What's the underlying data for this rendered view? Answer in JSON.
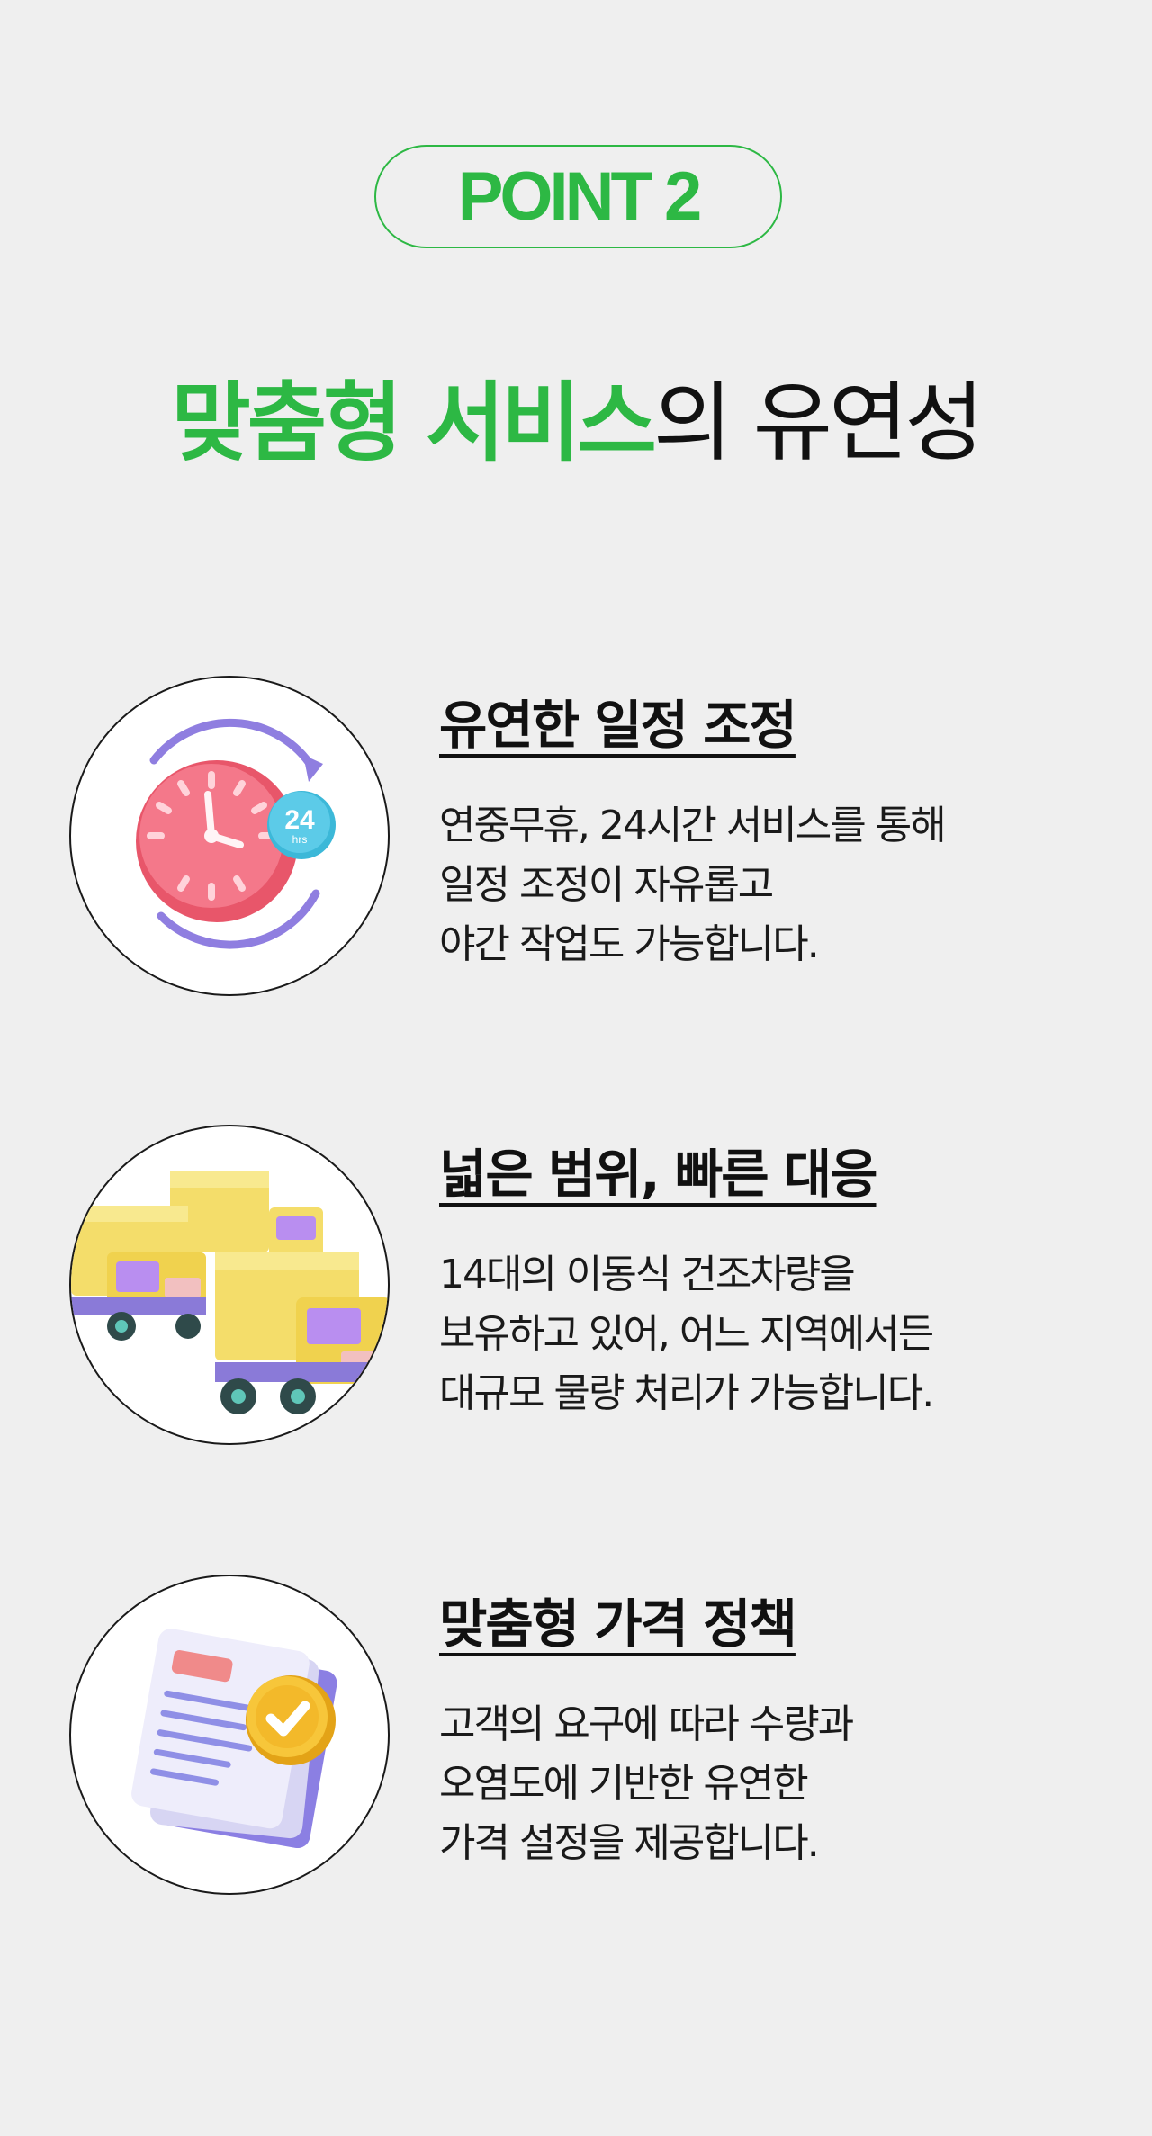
{
  "badge": {
    "label": "POINT 2"
  },
  "heading": {
    "highlight": "맞춤형 서비스",
    "rest": "의 유연성"
  },
  "features": [
    {
      "title": "유연한 일정 조정",
      "icon": "clock-24hrs-icon",
      "clock_badge_number": "24",
      "clock_badge_unit": "hrs",
      "lines": [
        "연중무휴, 24시간 서비스를 통해",
        "일정 조정이 자유롭고",
        "야간 작업도 가능합니다."
      ]
    },
    {
      "title": "넓은 범위, 빠른 대응",
      "icon": "delivery-trucks-icon",
      "lines": [
        "14대의 이동식 건조차량을",
        "보유하고 있어, 어느 지역에서든",
        "대규모 물량 처리가 가능합니다."
      ]
    },
    {
      "title": "맞춤형 가격 정책",
      "icon": "document-check-icon",
      "lines": [
        "고객의 요구에 따라 수량과",
        "오염도에 기반한 유연한",
        "가격 설정을 제공합니다."
      ]
    }
  ],
  "colors": {
    "accent": "#2db844",
    "background": "#efefef",
    "text": "#111111"
  }
}
